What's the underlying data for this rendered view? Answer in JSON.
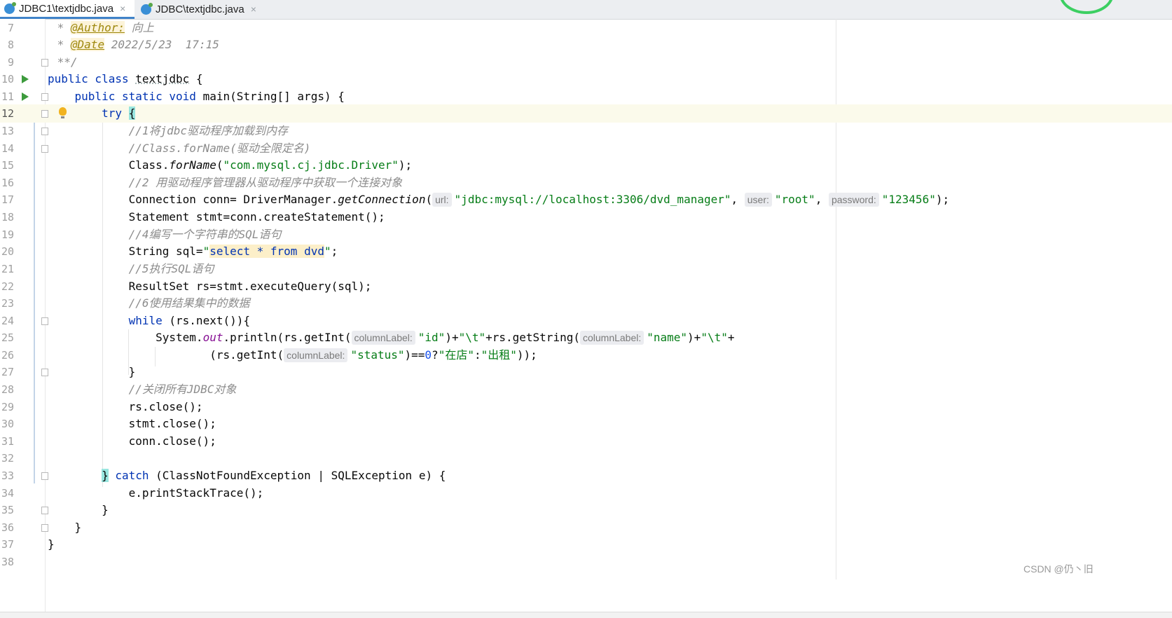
{
  "tabs": [
    {
      "label": "JDBC1\\textjdbc.java",
      "active": true
    },
    {
      "label": "JDBC\\textjdbc.java",
      "active": false
    }
  ],
  "tab_close_glyph": "×",
  "editor": {
    "line_numbers": [
      "7",
      "8",
      "9",
      "10",
      "11",
      "12",
      "13",
      "14",
      "15",
      "16",
      "17",
      "18",
      "19",
      "20",
      "21",
      "22",
      "23",
      "24",
      "25",
      "26",
      "27",
      "28",
      "29",
      "30",
      "31",
      "32",
      "33",
      "34",
      "35",
      "36",
      "37",
      "38"
    ],
    "current_line": "12",
    "hints": {
      "url": "url:",
      "user": "user:",
      "password": "password:",
      "columnLabel": "columnLabel:"
    },
    "lines": {
      "l7_a": " * ",
      "l7_anno": "@Author:",
      "l7_b": " 向上",
      "l8_a": " * ",
      "l8_anno": "@Date",
      "l8_b": " 2022/5/23  17:15",
      "l9": " **/",
      "l10_kw": "public class ",
      "l10_name": "textjdbc",
      "l10_end": " {",
      "l11_kw": "    public static void ",
      "l11_end": "main(String[] args) {",
      "l12_kw": "        try ",
      "l12_brace": "{",
      "l13": "            //1将jdbc驱动程序加载到内存",
      "l14": "            //Class.forName(驱动全限定名)",
      "l15_a": "            Class.",
      "l15_m": "forName",
      "l15_b": "(",
      "l15_s": "\"com.mysql.cj.jdbc.Driver\"",
      "l15_c": ");",
      "l16": "            //2 用驱动程序管理器从驱动程序中获取一个连接对象",
      "l17_a": "            Connection conn= DriverManager.",
      "l17_m": "getConnection",
      "l17_b": "(",
      "l17_s1": "\"jdbc:mysql://localhost:3306/dvd_manager\"",
      "l17_c1": ", ",
      "l17_s2": "\"root\"",
      "l17_c2": ", ",
      "l17_s3": "\"123456\"",
      "l17_end": ");",
      "l18": "            Statement stmt=conn.createStatement();",
      "l19": "            //4编写一个字符串的SQL语句",
      "l20_a": "            String sql=",
      "l20_q1": "\"",
      "l20_sql": "select * from dvd",
      "l20_q2": "\"",
      "l20_end": ";",
      "l21": "            //5执行SQL语句",
      "l22": "            ResultSet rs=stmt.executeQuery(sql);",
      "l23": "            //6使用结果集中的数据",
      "l24_kw": "            while",
      "l24_end": " (rs.next()){",
      "l25_a": "                System.",
      "l25_out": "out",
      "l25_b": ".println(rs.getInt(",
      "l25_s1": "\"id\"",
      "l25_c": ")+",
      "l25_s2": "\"\\t\"",
      "l25_d": "+rs.getString(",
      "l25_s3": "\"name\"",
      "l25_e": ")+",
      "l25_s4": "\"\\t\"",
      "l25_f": "+",
      "l26_a": "                        (rs.getInt(",
      "l26_s1": "\"status\"",
      "l26_b": ")==",
      "l26_n": "0",
      "l26_c": "?",
      "l26_s2": "\"在店\"",
      "l26_d": ":",
      "l26_s3": "\"出租\"",
      "l26_end": "));",
      "l27": "            }",
      "l28": "            //关闭所有JDBC对象",
      "l29": "            rs.close();",
      "l30": "            stmt.close();",
      "l31": "            conn.close();",
      "l32": "",
      "l33_pre": "        ",
      "l33_brace": "}",
      "l33_kw": " catch",
      "l33_end": " (ClassNotFoundException | SQLException e) {",
      "l34": "            e.printStackTrace();",
      "l35": "        }",
      "l36": "    }",
      "l37": "}",
      "l38": ""
    }
  },
  "watermark": "CSDN @仍丶旧",
  "colors": {
    "keyword": "#0033b3",
    "string": "#067d17",
    "comment": "#8c8c8c",
    "number": "#1750eb",
    "field": "#871094",
    "current_line_bg": "#fbfaeb",
    "tab_accent": "#4083c9"
  },
  "icons": {
    "run": "run-gutter-icon",
    "fold": "fold-icon",
    "bulb": "intention-bulb-icon",
    "file": "java-class-file-icon"
  }
}
